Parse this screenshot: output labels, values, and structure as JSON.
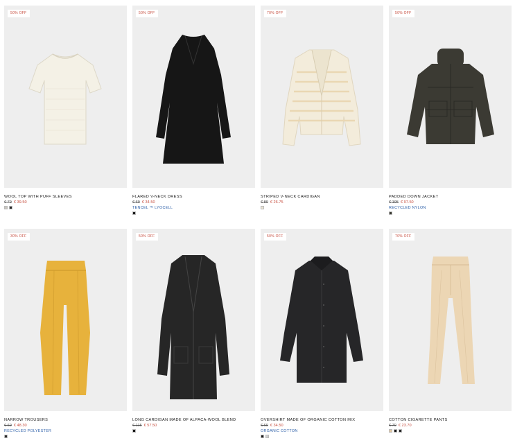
{
  "products": [
    {
      "badge": "50% OFF",
      "name": "WOOL TOP WITH PUFF SLEEVES",
      "old_price": "€ 79",
      "new_price": "€ 39.50",
      "material": "",
      "swatches": [
        "#c9c6bf",
        "#2a2a2a"
      ]
    },
    {
      "badge": "50% OFF",
      "name": "FLARED V-NECK DRESS",
      "old_price": "€ 69",
      "new_price": "€ 34.50",
      "material": "TENCEL ™ LYOCELL",
      "swatches": [
        "#1a1a1a"
      ]
    },
    {
      "badge": "70% OFF",
      "name": "STRIPED V-NECK CARDIGAN",
      "old_price": "€ 89",
      "new_price": "€ 26.75",
      "material": "",
      "swatches": [
        "#ece6d6"
      ]
    },
    {
      "badge": "50% OFF",
      "name": "PADDED DOWN JACKET",
      "old_price": "€ 195",
      "new_price": "€ 97.50",
      "material": "RECYCLED NYLON",
      "swatches": [
        "#3a3a32"
      ]
    },
    {
      "badge": "30% OFF",
      "name": "NARROW TROUSERS",
      "old_price": "€ 69",
      "new_price": "€ 48.30",
      "material": "RECYCLED POLYESTER",
      "swatches": [
        "#2a2a2a"
      ]
    },
    {
      "badge": "50% OFF",
      "name": "LONG CARDIGAN MADE OF ALPACA-WOOL BLEND",
      "old_price": "€ 115",
      "new_price": "€ 57.50",
      "material": "",
      "swatches": [
        "#1a1a1a"
      ]
    },
    {
      "badge": "50% OFF",
      "name": "OVERSHIRT MADE OF ORGANIC COTTON MIX",
      "old_price": "€ 69",
      "new_price": "€ 34.50",
      "material": "ORGANIC COTTON",
      "swatches": [
        "#1a1a1a",
        "#cfcfcf"
      ]
    },
    {
      "badge": "70% OFF",
      "name": "COTTON CIGARETTE PANTS",
      "old_price": "€ 79",
      "new_price": "€ 23.70",
      "material": "",
      "swatches": [
        "#e3c8a2",
        "#1a1a1a",
        "#2a2a2a"
      ]
    }
  ],
  "garment_colors": [
    "#f4f1e6",
    "#161616",
    "#f3ecdb",
    "#3b3a33",
    "#e7b23c",
    "#262626",
    "#262628",
    "#ecd6b4"
  ]
}
